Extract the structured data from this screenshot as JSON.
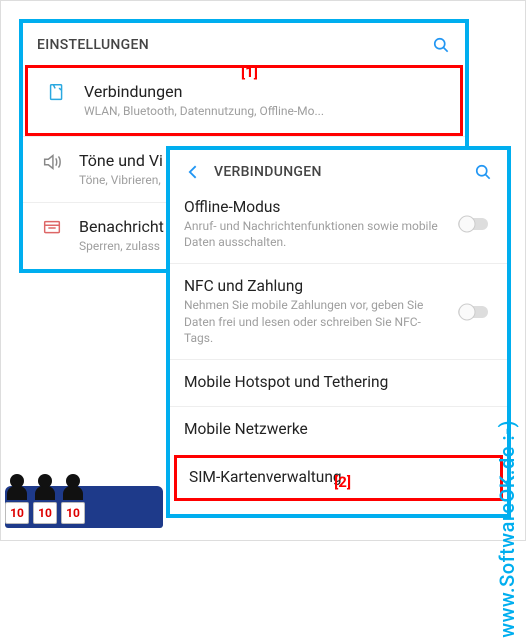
{
  "panel1": {
    "title": "EINSTELLUNGEN",
    "items": [
      {
        "label": "Verbindungen",
        "sub": "WLAN, Bluetooth, Datennutzung, Offline-Mo..."
      },
      {
        "label": "Töne und Vi",
        "sub": "Töne, Vibrieren,"
      },
      {
        "label": "Benachricht",
        "sub": "Sperren, zulass"
      }
    ]
  },
  "panel2": {
    "title": "VERBINDUNGEN",
    "items": [
      {
        "label": "Offline-Modus",
        "sub": "Anruf- und Nachrichtenfunktionen sowie mobile Daten ausschalten.",
        "toggle": true
      },
      {
        "label": "NFC und Zahlung",
        "sub": "Nehmen Sie mobile Zahlungen vor, geben Sie Daten frei und lesen oder schreiben Sie NFC-Tags.",
        "toggle": true
      },
      {
        "label": "Mobile Hotspot und Tethering"
      },
      {
        "label": "Mobile Netzwerke"
      },
      {
        "label": "SIM-Kartenverwaltung"
      }
    ]
  },
  "markers": {
    "m1": "[1]",
    "m2": "[2]"
  },
  "watermark": "www.SoftwareOK.de :-)",
  "judges": {
    "score": "10"
  }
}
